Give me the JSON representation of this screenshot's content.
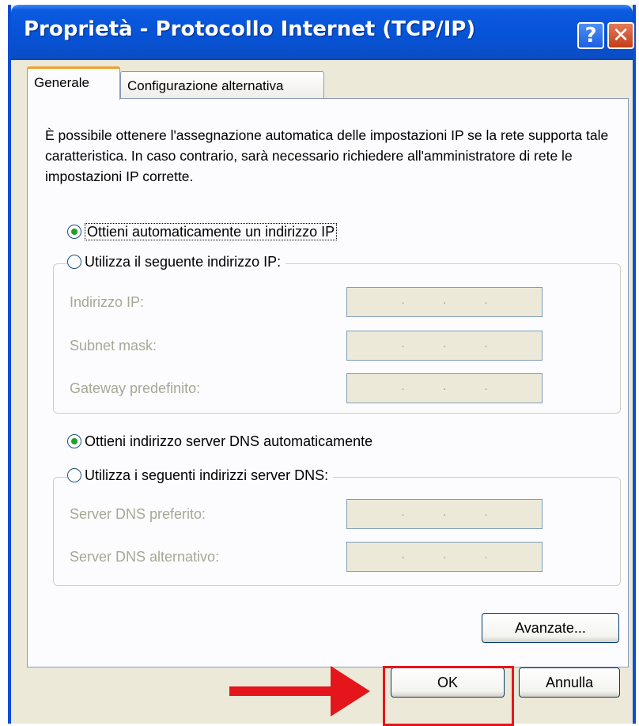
{
  "window": {
    "title": "Proprietà - Protocollo Internet (TCP/IP)",
    "help_glyph": "?",
    "close_glyph": "✕"
  },
  "tabs": [
    {
      "label": "Generale",
      "selected": true
    },
    {
      "label": "Configurazione alternativa",
      "selected": false
    }
  ],
  "intro_text": "È possibile ottenere l'assegnazione automatica delle impostazioni IP se la rete supporta tale caratteristica. In caso contrario, sarà necessario richiedere all'amministratore di rete le impostazioni IP corrette.",
  "ip_section": {
    "auto_option": {
      "label": "Ottieni automaticamente un indirizzo IP",
      "checked": true
    },
    "manual_option": {
      "label": "Utilizza il seguente indirizzo IP:",
      "checked": false
    },
    "fields": [
      {
        "label": "Indirizzo IP:",
        "value": "..."
      },
      {
        "label": "Subnet mask:",
        "value": "..."
      },
      {
        "label": "Gateway predefinito:",
        "value": "..."
      }
    ]
  },
  "dns_section": {
    "auto_option": {
      "label": "Ottieni indirizzo server DNS automaticamente",
      "checked": true
    },
    "manual_option": {
      "label": "Utilizza i seguenti indirizzi server DNS:",
      "checked": false
    },
    "fields": [
      {
        "label": "Server DNS preferito:",
        "value": "..."
      },
      {
        "label": "Server DNS alternativo:",
        "value": "..."
      }
    ]
  },
  "buttons": {
    "advanced": "Avanzate...",
    "ok": "OK",
    "cancel": "Annulla"
  },
  "colors": {
    "title_bar": "#0653d6",
    "highlight": "#e4161c",
    "radio_dot": "#21a121"
  },
  "icons": [
    "help-icon",
    "close-icon",
    "arrow-right-icon"
  ]
}
